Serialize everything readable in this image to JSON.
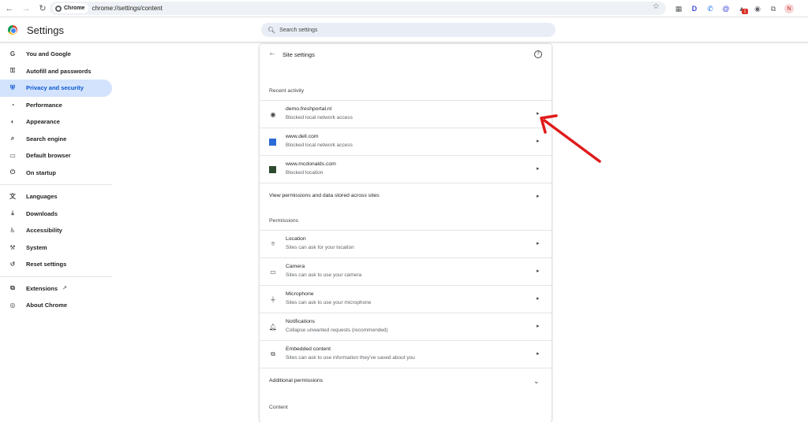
{
  "browser": {
    "chip_label": "Chrome",
    "url": "chrome://settings/content",
    "profile_initial": "N",
    "extension_badge": "1"
  },
  "header": {
    "title": "Settings",
    "search_placeholder": "Search settings"
  },
  "sidebar": {
    "items": [
      {
        "label": "You and Google",
        "icon": "google-icon"
      },
      {
        "label": "Autofill and passwords",
        "icon": "key-icon"
      },
      {
        "label": "Privacy and security",
        "icon": "shield-icon",
        "active": true
      },
      {
        "label": "Performance",
        "icon": "speedometer-icon"
      },
      {
        "label": "Appearance",
        "icon": "palette-icon"
      },
      {
        "label": "Search engine",
        "icon": "search-icon"
      },
      {
        "label": "Default browser",
        "icon": "browser-icon"
      },
      {
        "label": "On startup",
        "icon": "power-icon"
      }
    ],
    "items2": [
      {
        "label": "Languages",
        "icon": "translate-icon"
      },
      {
        "label": "Downloads",
        "icon": "download-icon"
      },
      {
        "label": "Accessibility",
        "icon": "accessibility-icon"
      },
      {
        "label": "System",
        "icon": "wrench-icon"
      },
      {
        "label": "Reset settings",
        "icon": "reset-icon"
      }
    ],
    "items3": [
      {
        "label": "Extensions",
        "icon": "puzzle-icon"
      },
      {
        "label": "About Chrome",
        "icon": "chrome-icon"
      }
    ]
  },
  "panel": {
    "title": "Site settings",
    "recent_activity_title": "Recent activity",
    "recent": [
      {
        "site": "demo.freshportal.nl",
        "detail": "Blocked local network access"
      },
      {
        "site": "www.dell.com",
        "detail": "Blocked local network access"
      },
      {
        "site": "www.mcdonalds.com",
        "detail": "Blocked location"
      }
    ],
    "view_all_label": "View permissions and data stored across sites",
    "permissions_title": "Permissions",
    "permissions": [
      {
        "name": "Location",
        "detail": "Sites can ask for your location",
        "icon": "location-pin-icon"
      },
      {
        "name": "Camera",
        "detail": "Sites can ask to use your camera",
        "icon": "camera-icon"
      },
      {
        "name": "Microphone",
        "detail": "Sites can ask to use your microphone",
        "icon": "microphone-icon"
      },
      {
        "name": "Notifications",
        "detail": "Collapse unwanted requests (recommended)",
        "icon": "bell-icon"
      },
      {
        "name": "Embedded content",
        "detail": "Sites can ask to use information they've saved about you",
        "icon": "embedded-content-icon"
      }
    ],
    "additional_permissions_label": "Additional permissions",
    "content_title": "Content"
  },
  "colors": {
    "accent": "#0b57d0",
    "active_bg": "#d3e3fd",
    "annotation_arrow": "#e01b1b"
  }
}
